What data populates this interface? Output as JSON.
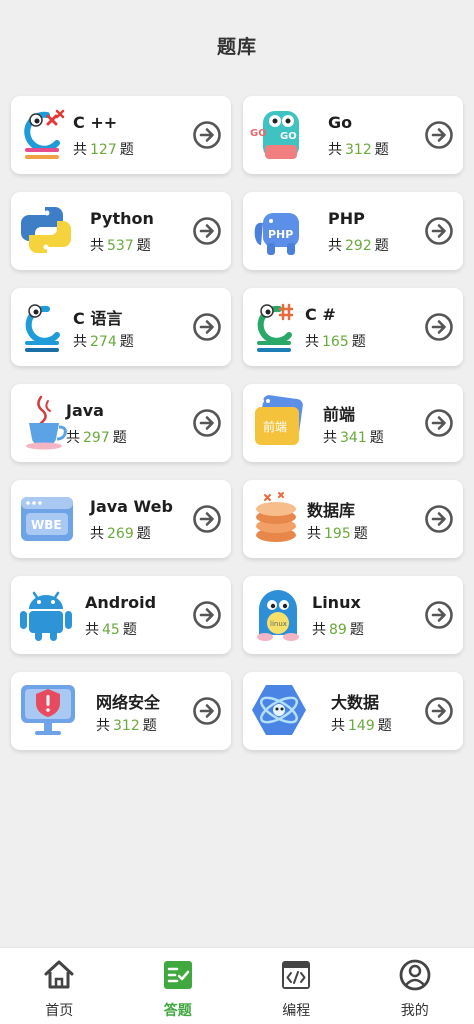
{
  "header": {
    "title": "题库"
  },
  "count_prefix": "共",
  "count_suffix": "题",
  "courses": [
    {
      "name": "C ++",
      "count": "127"
    },
    {
      "name": "Go",
      "count": "312"
    },
    {
      "name": "Python",
      "count": "537"
    },
    {
      "name": "PHP",
      "count": "292"
    },
    {
      "name": "C 语言",
      "count": "274"
    },
    {
      "name": "C #",
      "count": "165"
    },
    {
      "name": "Java",
      "count": "297"
    },
    {
      "name": "前端",
      "count": "341"
    },
    {
      "name": "Java Web",
      "count": "269"
    },
    {
      "name": "数据库",
      "count": "195"
    },
    {
      "name": "Android",
      "count": "45"
    },
    {
      "name": "Linux",
      "count": "89"
    },
    {
      "name": "网络安全",
      "count": "312"
    },
    {
      "name": "大数据",
      "count": "149"
    }
  ],
  "icon_text": {
    "go": "GO",
    "php": "PHP",
    "frontend": "前端",
    "wbe": "WBE",
    "linux": "linux"
  },
  "tabbar": {
    "home": "首页",
    "quiz": "答题",
    "code": "编程",
    "mine": "我的"
  },
  "colors": {
    "accent": "#3fa83f",
    "count": "#6aaa3c"
  }
}
